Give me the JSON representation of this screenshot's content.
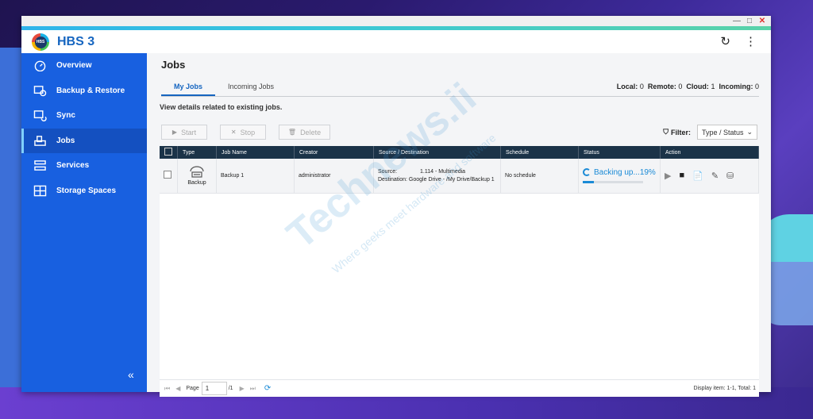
{
  "app": {
    "title": "HBS 3",
    "logo_text": "HBS"
  },
  "window_controls": {
    "minimize": "—",
    "maximize": "□",
    "close": "✕"
  },
  "sidebar": {
    "items": [
      {
        "label": "Overview",
        "icon": "gauge-icon"
      },
      {
        "label": "Backup & Restore",
        "icon": "backup-restore-icon"
      },
      {
        "label": "Sync",
        "icon": "sync-icon"
      },
      {
        "label": "Jobs",
        "icon": "jobs-icon",
        "active": true
      },
      {
        "label": "Services",
        "icon": "services-icon"
      },
      {
        "label": "Storage Spaces",
        "icon": "storage-icon"
      }
    ],
    "collapse": "«"
  },
  "main": {
    "title": "Jobs",
    "tabs": [
      {
        "label": "My Jobs",
        "active": true
      },
      {
        "label": "Incoming Jobs"
      }
    ],
    "counts": {
      "local_label": "Local:",
      "local": "0",
      "remote_label": "Remote:",
      "remote": "0",
      "cloud_label": "Cloud:",
      "cloud": "1",
      "incoming_label": "Incoming:",
      "incoming": "0"
    },
    "description": "View details related to existing jobs."
  },
  "toolbar": {
    "start": "Start",
    "stop": "Stop",
    "delete": "Delete"
  },
  "filter": {
    "label": "Filter:",
    "value": "Type / Status"
  },
  "table": {
    "headers": [
      "Type",
      "Job Name",
      "Creator",
      "Source / Destination",
      "Schedule",
      "Status",
      "Action"
    ],
    "rows": [
      {
        "type": "Backup",
        "job_name": "Backup 1",
        "creator": "administrator",
        "source_label": "Source:",
        "source": "1.114 - Multimedia",
        "dest_label": "Destination:",
        "destination": "Google Drive - /My Drive/Backup 1",
        "schedule": "No schedule",
        "status": "Backing up...19%",
        "progress": 0.19
      }
    ]
  },
  "pager": {
    "page_label": "Page",
    "page": "1",
    "of": "/1",
    "display": "Display item: 1-1, Total: 1"
  },
  "watermark": {
    "main": "Technews.ii",
    "tagline": "Where geeks meet hardware and software"
  },
  "colors": {
    "sidebar": "#1860e0",
    "accent": "#1565c0",
    "table_header": "#1b3348",
    "status": "#1a8ad6"
  }
}
